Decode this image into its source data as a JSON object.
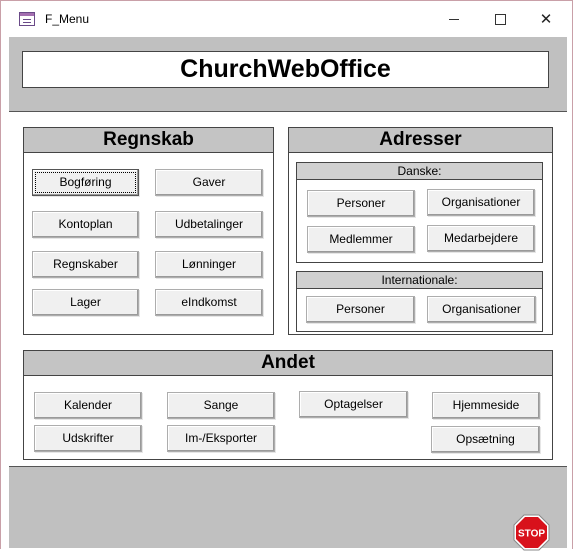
{
  "window": {
    "title": "F_Menu",
    "minimize_glyph": "",
    "maximize_glyph": "",
    "close_glyph": "✕"
  },
  "header": {
    "app_title": "ChurchWebOffice"
  },
  "regnskab": {
    "title": "Regnskab",
    "buttons": [
      "Bogføring",
      "Gaver",
      "Kontoplan",
      "Udbetalinger",
      "Regnskaber",
      "Lønninger",
      "Lager",
      "eIndkomst"
    ]
  },
  "adresser": {
    "title": "Adresser",
    "danske": {
      "title": "Danske:",
      "buttons": [
        "Personer",
        "Organisationer",
        "Medlemmer",
        "Medarbejdere"
      ]
    },
    "internationale": {
      "title": "Internationale:",
      "buttons": [
        "Personer",
        "Organisationer"
      ]
    }
  },
  "andet": {
    "title": "Andet",
    "buttons": [
      "Kalender",
      "Sange",
      "Optagelser",
      "Hjemmeside",
      "Udskrifter",
      "Im-/Eksporter",
      "Opsætning"
    ]
  },
  "footer": {
    "stop_label": "STOP",
    "stop_icon": "stop-sign-icon",
    "stop_color": "#d8111b"
  }
}
